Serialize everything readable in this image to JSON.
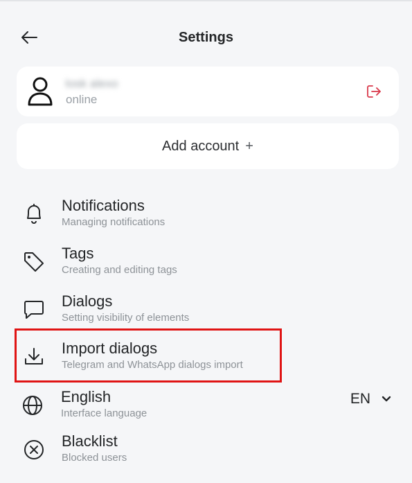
{
  "header": {
    "title": "Settings",
    "back_icon": "arrow-left-icon"
  },
  "account": {
    "name": "Iosk alexo",
    "status": "online",
    "avatar_icon": "user-icon",
    "logout_icon": "logout-icon",
    "logout_color": "#d9384a"
  },
  "add_account": {
    "label": "Add account",
    "plus": "+"
  },
  "menu": {
    "notifications": {
      "title": "Notifications",
      "subtitle": "Managing notifications",
      "icon": "bell-icon"
    },
    "tags": {
      "title": "Tags",
      "subtitle": "Creating and editing tags",
      "icon": "tag-icon"
    },
    "dialogs": {
      "title": "Dialogs",
      "subtitle": "Setting visibility of elements",
      "icon": "chat-bubble-icon"
    },
    "import": {
      "title": "Import dialogs",
      "subtitle": "Telegram and WhatsApp dialogs import",
      "icon": "download-icon"
    },
    "language": {
      "title": "English",
      "subtitle": "Interface language",
      "icon": "globe-icon",
      "code": "EN"
    },
    "blacklist": {
      "title": "Blacklist",
      "subtitle": "Blocked users",
      "icon": "close-circle-icon"
    }
  },
  "highlight_color": "#e01414"
}
